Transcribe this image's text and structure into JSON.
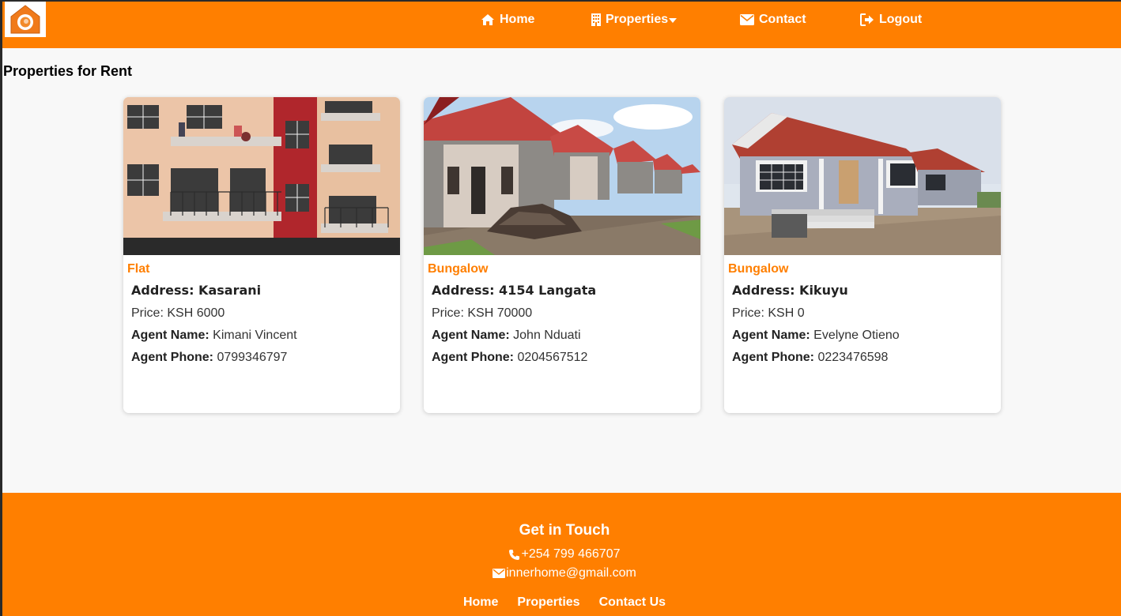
{
  "colors": {
    "brand": "#ff7f00",
    "background": "#f8f8f8",
    "card": "#ffffff"
  },
  "nav": {
    "logo_icon": "house-logo-icon",
    "home": "Home",
    "properties": "Properties",
    "contact": "Contact",
    "logout": "Logout"
  },
  "page": {
    "heading": "Properties for Rent"
  },
  "properties": [
    {
      "type": "Flat",
      "address": "Address: Kasarani",
      "price": "Price: KSH 6000",
      "agent_label": "Agent Name:",
      "agent": "Kimani Vincent",
      "phone_label": "Agent Phone:",
      "phone": "0799346797",
      "image": "apartment-block-photo"
    },
    {
      "type": "Bungalow",
      "address": "Address: 4154 Langata",
      "price": "Price: KSH 70000",
      "agent_label": "Agent Name:",
      "agent": "John Nduati",
      "phone_label": "Agent Phone:",
      "phone": "0204567512",
      "image": "bungalow-row-photo"
    },
    {
      "type": "Bungalow",
      "address": "Address: Kikuyu",
      "price": "Price: KSH 0",
      "agent_label": "Agent Name:",
      "agent": "Evelyne Otieno",
      "phone_label": "Agent Phone:",
      "phone": "0223476598",
      "image": "bungalow-house-photo"
    }
  ],
  "footer": {
    "title": "Get in Touch",
    "phone": "+254 799 466707",
    "email": "innerhome@gmail.com",
    "links": [
      "Home",
      "Properties",
      "Contact Us"
    ]
  }
}
